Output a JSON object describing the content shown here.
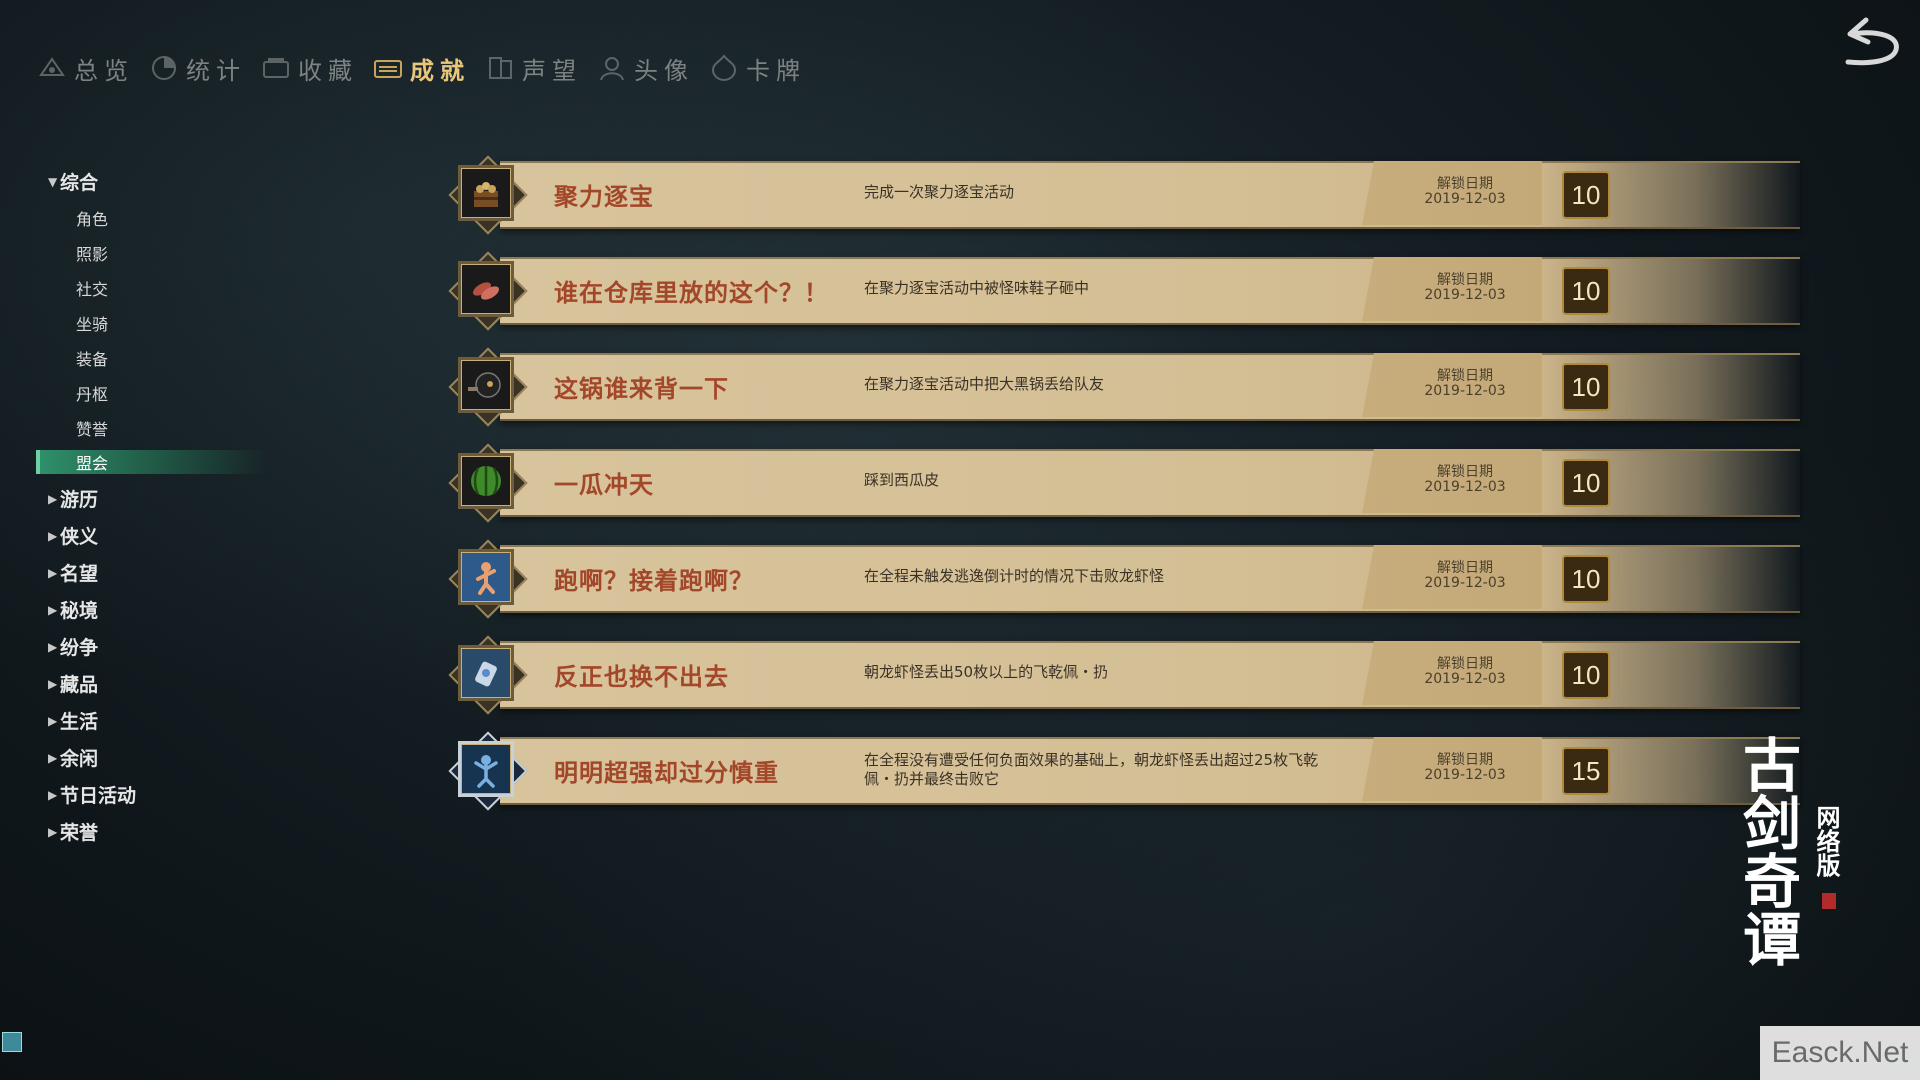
{
  "tabs": [
    {
      "label": "总览",
      "icon": "overview-icon",
      "active": false
    },
    {
      "label": "统计",
      "icon": "statistics-icon",
      "active": false
    },
    {
      "label": "收藏",
      "icon": "collection-icon",
      "active": false
    },
    {
      "label": "成就",
      "icon": "achievement-icon",
      "active": true
    },
    {
      "label": "声望",
      "icon": "reputation-icon",
      "active": false
    },
    {
      "label": "头像",
      "icon": "avatar-icon",
      "active": false
    },
    {
      "label": "卡牌",
      "icon": "card-icon",
      "active": false
    }
  ],
  "sidebar": {
    "expanded": {
      "label": "综合",
      "children": [
        "角色",
        "照影",
        "社交",
        "坐骑",
        "装备",
        "丹枢",
        "赞誉",
        "盟会"
      ],
      "active": "盟会"
    },
    "collapsed": [
      "游历",
      "侠义",
      "名望",
      "秘境",
      "纷争",
      "藏品",
      "生活",
      "余闲",
      "节日活动",
      "荣誉"
    ]
  },
  "achievements": [
    {
      "title": "聚力逐宝",
      "description": "完成一次聚力逐宝活动",
      "date_label": "解锁日期",
      "date": "2019-12-03",
      "points": "10",
      "icon": "treasure-chest-icon"
    },
    {
      "title": "谁在仓库里放的这个？！",
      "description": "在聚力逐宝活动中被怪味鞋子砸中",
      "date_label": "解锁日期",
      "date": "2019-12-03",
      "points": "10",
      "icon": "shoes-icon"
    },
    {
      "title": "这锅谁来背一下",
      "description": "在聚力逐宝活动中把大黑锅丢给队友",
      "date_label": "解锁日期",
      "date": "2019-12-03",
      "points": "10",
      "icon": "black-pot-icon"
    },
    {
      "title": "一瓜冲天",
      "description": "踩到西瓜皮",
      "date_label": "解锁日期",
      "date": "2019-12-03",
      "points": "10",
      "icon": "watermelon-icon"
    },
    {
      "title": "跑啊？接着跑啊？",
      "description": "在全程未触发逃逸倒计时的情况下击败龙虾怪",
      "date_label": "解锁日期",
      "date": "2019-12-03",
      "points": "10",
      "icon": "runner-icon"
    },
    {
      "title": "反正也换不出去",
      "description": "朝龙虾怪丢出50枚以上的飞乾佩・扔",
      "date_label": "解锁日期",
      "date": "2019-12-03",
      "points": "10",
      "icon": "jade-pendant-icon"
    },
    {
      "title": "明明超强却过分慎重",
      "description": "在全程没有遭受任何负面效果的基础上，朝龙虾怪丢出超过25枚飞乾佩・扔并最终击败它",
      "date_label": "解锁日期",
      "date": "2019-12-03",
      "points": "15",
      "icon": "warrior-icon"
    }
  ],
  "logo": {
    "main": "古剑奇谭",
    "sub": "网络版"
  },
  "watermark": "Easck.Net",
  "colors": {
    "accent_gold": "#e9c77a",
    "title_red": "#a3472a",
    "active_green": "#30966e"
  }
}
